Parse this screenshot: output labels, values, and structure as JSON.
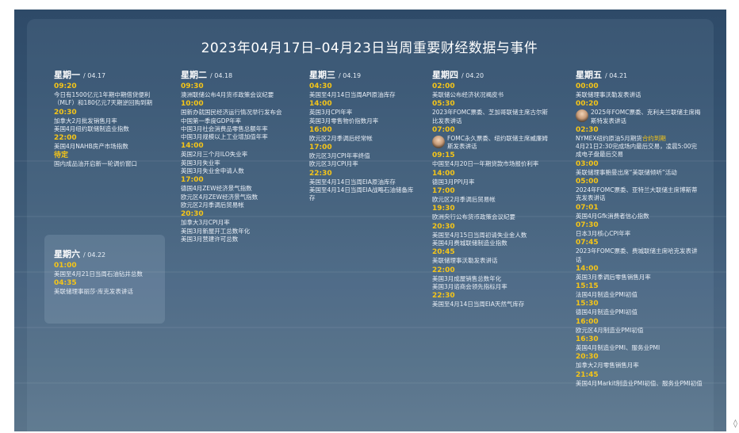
{
  "title": "2023年04月17日–04月23日当周重要财经数据与事件",
  "days": {
    "mon": {
      "name": "星期一",
      "date": "/ 04.17",
      "items": [
        {
          "time": "09:20",
          "events": [
            "今日有1500亿元1年期中期借贷便利（MLF）和180亿元7天期逆回购到期"
          ]
        },
        {
          "time": "20:30",
          "events": [
            "加拿大2月批发销售月率",
            "美国4月纽约联储制造业指数"
          ]
        },
        {
          "time": "22:00",
          "events": [
            "美国4月NAHB房产市场指数"
          ]
        },
        {
          "time": "待定",
          "events": [
            "国内成品油开启新一轮调价窗口"
          ]
        }
      ]
    },
    "tue": {
      "name": "星期二",
      "date": "/ 04.18",
      "items": [
        {
          "time": "09:30",
          "events": [
            "澳洲联储公布4月货币政策会议纪要"
          ]
        },
        {
          "time": "10:00",
          "events": [
            "国新办就国民经济运行情况举行发布会",
            "中国第一季度GDP年率",
            "中国3月社会消费品零售总额年率",
            "中国3月规模以上工业增加值年率"
          ]
        },
        {
          "time": "14:00",
          "events": [
            "英国2月三个月ILO失业率",
            "英国3月失业率",
            "英国3月失业金申请人数"
          ]
        },
        {
          "time": "17:00",
          "events": [
            "德国4月ZEW经济景气指数",
            "欧元区4月ZEW经济景气指数",
            "欧元区2月季调后贸易帐"
          ]
        },
        {
          "time": "20:30",
          "events": [
            "加拿大3月CPI月率",
            "美国3月新屋开工总数年化",
            "美国3月营建许可总数"
          ]
        }
      ]
    },
    "wed": {
      "name": "星期三",
      "date": "/ 04.19",
      "items": [
        {
          "time": "04:30",
          "events": [
            "美国至4月14日当周API原油库存"
          ]
        },
        {
          "time": "14:00",
          "events": [
            "英国3月CPI年率",
            "英国3月零售物价指数月率"
          ]
        },
        {
          "time": "16:00",
          "events": [
            "欧元区2月季调后经常帐"
          ]
        },
        {
          "time": "17:00",
          "events": [
            "欧元区3月CPI年率终值",
            "欧元区3月CPI月率"
          ]
        },
        {
          "time": "22:30",
          "events": [
            "美国至4月14日当周EIA原油库存",
            "美国至4月14日当周EIA战略石油储备库存"
          ]
        }
      ]
    },
    "thu": {
      "name": "星期四",
      "date": "/ 04.20",
      "items": [
        {
          "time": "02:00",
          "events": [
            "美联储公布经济状况褐皮书"
          ]
        },
        {
          "time": "05:30",
          "events": [
            "2023年FOMC票委、芝加哥联储主席古尔斯比发表讲话"
          ]
        },
        {
          "time": "07:00",
          "events": [
            "FOMC永久票委、纽约联储主席威廉姆斯发表讲话"
          ],
          "avatar": true
        },
        {
          "time": "09:15",
          "events": [
            "中国至4月20日一年期贷款市场报价利率"
          ]
        },
        {
          "time": "14:00",
          "events": [
            "德国3月PPI月率"
          ]
        },
        {
          "time": "17:00",
          "events": [
            "欧元区2月季调后贸易帐"
          ]
        },
        {
          "time": "19:30",
          "events": [
            "欧洲央行公布货币政策会议纪要"
          ]
        },
        {
          "time": "20:30",
          "events": [
            "美国至4月15日当周初请失业金人数",
            "美国4月费城联储制造业指数"
          ]
        },
        {
          "time": "20:45",
          "events": [
            "美联储理事沃勒发表讲话"
          ]
        },
        {
          "time": "22:00",
          "events": [
            "美国3月成屋销售总数年化",
            "美国3月谘商会领先指标月率"
          ]
        },
        {
          "time": "22:30",
          "events": [
            "美国至4月14日当周EIA天然气库存"
          ]
        }
      ]
    },
    "fri": {
      "name": "星期五",
      "date": "/ 04.21",
      "items": [
        {
          "time": "00:00",
          "events": [
            "美联储理事沃勒发表讲话"
          ]
        },
        {
          "time": "00:20",
          "events": [
            "2025年FOMC票委、克利夫兰联储主席梅斯特发表讲话"
          ],
          "avatar": true
        },
        {
          "time": "02:30",
          "events": [
            "NYMEX纽约原油5月期货合约到期",
            "4月21日2:30完成场内最后交易，凌晨5:00完成电子盘最后交易"
          ],
          "highlight": "合约到期"
        },
        {
          "time": "03:00",
          "events": [
            "美联储理事鲍曼出席“美联储倾听”活动"
          ]
        },
        {
          "time": "05:00",
          "events": [
            "2024年FOMC票委、亚特兰大联储主席博斯蒂克发表讲话"
          ]
        },
        {
          "time": "07:01",
          "events": [
            "英国4月Gfk消费者信心指数"
          ]
        },
        {
          "time": "07:30",
          "events": [
            "日本3月核心CPI年率"
          ]
        },
        {
          "time": "07:45",
          "events": [
            "2023年FOMC票委、费城联储主席哈克发表讲话"
          ]
        },
        {
          "time": "14:00",
          "events": [
            "英国3月季调后零售销售月率"
          ]
        },
        {
          "time": "15:15",
          "events": [
            "法国4月制造业PMI初值"
          ]
        },
        {
          "time": "15:30",
          "events": [
            "德国4月制造业PMI初值"
          ]
        },
        {
          "time": "16:00",
          "events": [
            "欧元区4月制造业PMI初值"
          ]
        },
        {
          "time": "16:30",
          "events": [
            "英国4月制造业PMI、服务业PMI"
          ]
        },
        {
          "time": "20:30",
          "events": [
            "加拿大2月零售销售月率"
          ]
        },
        {
          "time": "21:45",
          "events": [
            "美国4月Markit制造业PMI初值、服务业PMI初值"
          ]
        }
      ]
    },
    "sat": {
      "name": "星期六",
      "date": "/ 04.22",
      "items": [
        {
          "time": "01:00",
          "events": [
            "美国至4月21日当周石油钻井总数"
          ]
        },
        {
          "time": "04:35",
          "events": [
            "美联储理事丽莎·库克发表讲话"
          ]
        }
      ]
    }
  },
  "corner_mark": "◊"
}
